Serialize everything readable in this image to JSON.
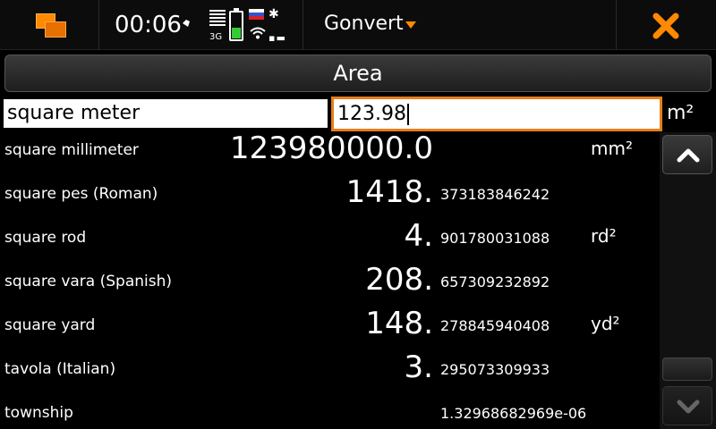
{
  "statusbar": {
    "time": "00:06",
    "network": "3G",
    "accent": "#ff8a00"
  },
  "app": {
    "title": "Gonvert",
    "close_icon": "close-icon"
  },
  "category": {
    "label": "Area"
  },
  "input": {
    "unit": "square meter",
    "value": "123.98",
    "symbol": "m²"
  },
  "results": [
    {
      "name": "square millimeter",
      "int": "123980000.0",
      "frac": "",
      "sym": "mm²"
    },
    {
      "name": "square pes (Roman)",
      "int": "1418.",
      "frac": "373183846242",
      "sym": ""
    },
    {
      "name": "square rod",
      "int": "4.",
      "frac": "901780031088",
      "sym": "rd²"
    },
    {
      "name": "square vara (Spanish)",
      "int": "208.",
      "frac": "657309232892",
      "sym": ""
    },
    {
      "name": "square yard",
      "int": "148.",
      "frac": "278845940408",
      "sym": "yd²"
    },
    {
      "name": "tavola (Italian)",
      "int": "3.",
      "frac": "295073309933",
      "sym": ""
    },
    {
      "name": "township",
      "int": "",
      "frac": "1.32968682969e-06",
      "sym": ""
    }
  ]
}
